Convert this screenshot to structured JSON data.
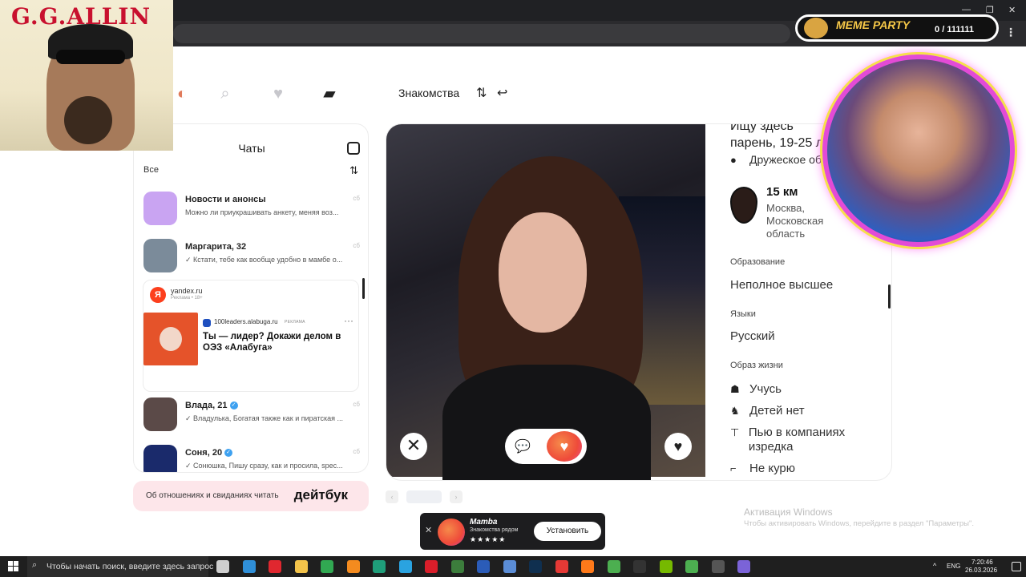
{
  "colors": {
    "accent": "#ef4b3a",
    "verified": "#3ea1f0",
    "ad_red": "#e5532a",
    "dateboox_bg": "#fde6ea",
    "taskbar": "#1f1f1f",
    "meme_gold": "#f7c948"
  },
  "overlay": {
    "gg_title": "G.G.ALLIN",
    "meme_title": "MEME PARTY",
    "meme_count": "0 / 111111"
  },
  "nav": {
    "icons": [
      "avatar-icon",
      "search-icon",
      "heart-icon",
      "cards-icon"
    ],
    "dating": "Знакомства",
    "filter_icon": "⇅",
    "back_icon": "↩"
  },
  "chats": {
    "title": "Чаты",
    "filter_all": "Все",
    "sort_icon": "⇅",
    "items": [
      {
        "name": "Новости и анонсы",
        "message": "Можно ли приукрашивать анкету, меняя воз...",
        "time": "сб",
        "verified": false,
        "avatar_color": "#c9a4f2"
      },
      {
        "name": "Маргарита, 32",
        "message": "✓ Кстати, тебе как вообще удобно в мамбе о...",
        "time": "сб",
        "verified": false,
        "avatar_color": "#7b8b9a"
      },
      {
        "name": "Влада, 21",
        "message": "✓ Владулька, Богатая также как и пиратская ...",
        "time": "сб",
        "verified": true,
        "avatar_color": "#5b4a48"
      },
      {
        "name": "Соня, 20",
        "message": "✓ Сонюшка, Пишу сразу, как и просила, spec...",
        "time": "сб",
        "verified": true,
        "avatar_color": "#1a2a6b"
      }
    ],
    "ad": {
      "logo": "Я",
      "domain": "yandex.ru",
      "label": "Реклама • 18+",
      "source": "100leaders.alabuga.ru",
      "source_tag": "РЕКЛАМА",
      "more": "···",
      "headline": "Ты — лидер? Докажи делом в ОЭЗ «Алабуга»"
    }
  },
  "dateboox": {
    "text": "Об отношениях и свиданиях читать",
    "logo": "дейтбук"
  },
  "profile": {
    "looking_for": "парень, 19-25 л",
    "looking_for_top": "Ищу здесь",
    "friendly": "Дружеское об",
    "distance": "15 км",
    "city": "Москва, Московская область",
    "education_label": "Образование",
    "education": "Неполное высшее",
    "languages_label": "Языки",
    "languages": "Русский",
    "lifestyle_label": "Образ жизни",
    "lifestyle": [
      {
        "icon": "bag-icon",
        "glyph": "☗",
        "text": "Учусь"
      },
      {
        "icon": "horse-icon",
        "glyph": "♞",
        "text": "Детей нет"
      },
      {
        "icon": "glass-icon",
        "glyph": "⊤",
        "text": "Пью в компаниях изредка"
      },
      {
        "icon": "no-smoke-icon",
        "glyph": "⌐",
        "text": "Не курю"
      }
    ]
  },
  "actions": {
    "dislike": "✕",
    "chat": "💬",
    "superlike": "♥",
    "like": "♥"
  },
  "pager": {
    "prev": "‹",
    "next": "›"
  },
  "windows": {
    "watermark": "Активация Windows",
    "watermark_sub": "Чтобы активировать Windows, перейдите в раздел \"Параметры\"."
  },
  "install": {
    "close": "✕",
    "title": "Mamba",
    "subtitle": "Знакомства рядом",
    "stars": "★★★★★",
    "button": "Установить"
  },
  "taskbar": {
    "search_placeholder": "Чтобы начать поиск, введите здесь запрос",
    "apps": [
      {
        "name": "task-view",
        "color": "#cfcfcf"
      },
      {
        "name": "explorer-app",
        "color": "#2f8fd8"
      },
      {
        "name": "opera-app",
        "color": "#e0272f"
      },
      {
        "name": "folder-app",
        "color": "#f3c34a"
      },
      {
        "name": "chart-app",
        "color": "#31a852"
      },
      {
        "name": "vlc-app",
        "color": "#f48b1f"
      },
      {
        "name": "zap-app",
        "color": "#1f9e7a"
      },
      {
        "name": "telegram-app",
        "color": "#2aa3e0"
      },
      {
        "name": "opera2-app",
        "color": "#d91e2a"
      },
      {
        "name": "terminal-app",
        "color": "#3c7d3c"
      },
      {
        "name": "word-app",
        "color": "#2b5cb8"
      },
      {
        "name": "files-app",
        "color": "#5b8dd6"
      },
      {
        "name": "photoshop-app",
        "color": "#0f2f4f"
      },
      {
        "name": "yandex-app",
        "color": "#e53935"
      },
      {
        "name": "firefox-app",
        "color": "#ff7a1a"
      },
      {
        "name": "chrome-app",
        "color": "#4caf50"
      },
      {
        "name": "obs-app",
        "color": "#333333"
      },
      {
        "name": "nvidia-app",
        "color": "#76b900"
      },
      {
        "name": "chrome2-app",
        "color": "#4caf50"
      },
      {
        "name": "misc-app",
        "color": "#555555"
      },
      {
        "name": "discord-app",
        "color": "#7b63d8"
      }
    ],
    "lang": "ENG",
    "time": "7:20:46",
    "date": "26.03.2026",
    "caret": "^"
  }
}
